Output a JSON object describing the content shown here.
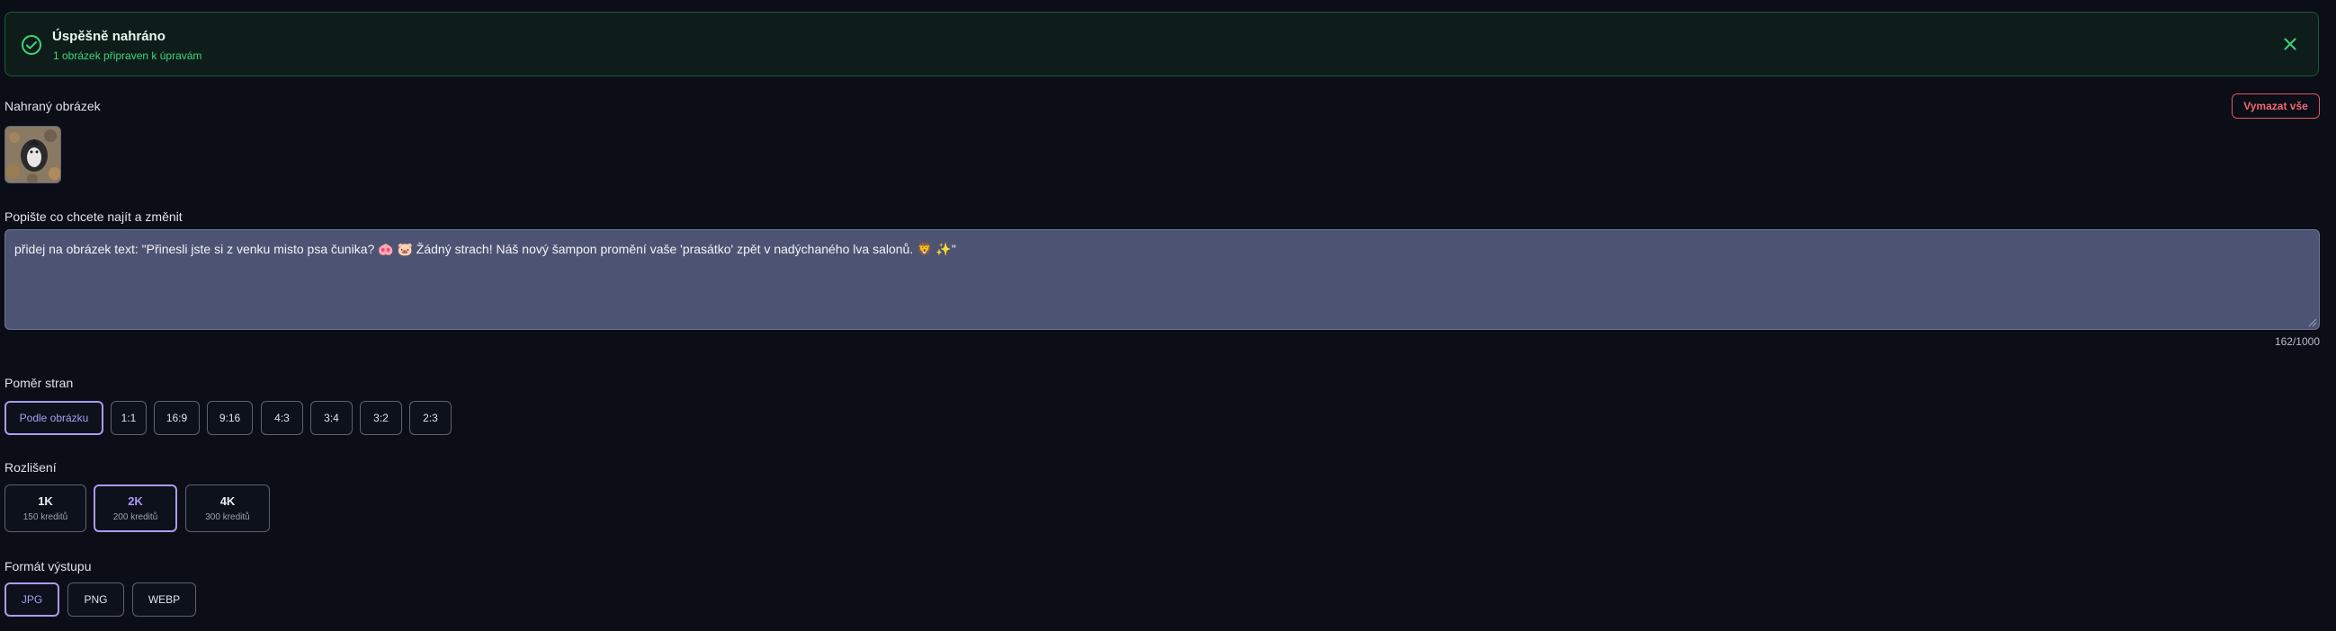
{
  "alert": {
    "title": "Úspěšně nahráno",
    "subtitle": "1 obrázek připraven k úpravám",
    "color": "#3fd47b"
  },
  "uploaded": {
    "label": "Nahraný obrázek",
    "clear_label": "Vymazat vše"
  },
  "prompt": {
    "label": "Popište co chcete najít a změnit",
    "value": "přidej na obrázek text: \"Přinesli jste si z venku misto psa čunika? 🐽 🐷 Žádný strach! Náš nový šampon promění vaše 'prasátko' zpět v nadýchaného lva salonů. 🦁 ✨\"",
    "counter": "162/1000"
  },
  "aspect": {
    "label": "Poměr stran",
    "options": [
      "Podle obrázku",
      "1:1",
      "16:9",
      "9:16",
      "4:3",
      "3:4",
      "3:2",
      "2:3"
    ],
    "selected": "Podle obrázku"
  },
  "resolution": {
    "label": "Rozlišení",
    "options": [
      {
        "name": "1K",
        "credits": "150 kreditů"
      },
      {
        "name": "2K",
        "credits": "200 kreditů"
      },
      {
        "name": "4K",
        "credits": "300 kreditů"
      }
    ],
    "selected": "2K"
  },
  "format": {
    "label": "Formát výstupu",
    "options": [
      "JPG",
      "PNG",
      "WEBP"
    ],
    "selected": "JPG"
  },
  "accent": "#a99cf3"
}
